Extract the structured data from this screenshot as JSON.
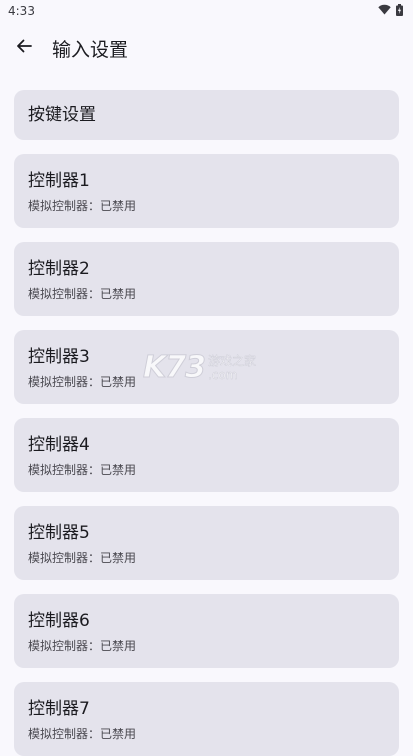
{
  "status_bar": {
    "time": "4:33",
    "icons": [
      "wifi-icon",
      "battery-icon"
    ]
  },
  "app_bar": {
    "back_icon": "arrow-left-icon",
    "title": "输入设置"
  },
  "items": [
    {
      "title": "按键设置"
    },
    {
      "title": "控制器1",
      "subtitle": "模拟控制器：已禁用"
    },
    {
      "title": "控制器2",
      "subtitle": "模拟控制器：已禁用"
    },
    {
      "title": "控制器3",
      "subtitle": "模拟控制器：已禁用"
    },
    {
      "title": "控制器4",
      "subtitle": "模拟控制器：已禁用"
    },
    {
      "title": "控制器5",
      "subtitle": "模拟控制器：已禁用"
    },
    {
      "title": "控制器6",
      "subtitle": "模拟控制器：已禁用"
    },
    {
      "title": "控制器7",
      "subtitle": "模拟控制器：已禁用"
    }
  ],
  "watermark": {
    "logo": "K73",
    "text": "游戏之家",
    "domain": ".com"
  },
  "colors": {
    "background": "#f9f8fd",
    "card": "#e4e3ec",
    "text": "#1b1b20",
    "subtext": "#4a4950"
  }
}
